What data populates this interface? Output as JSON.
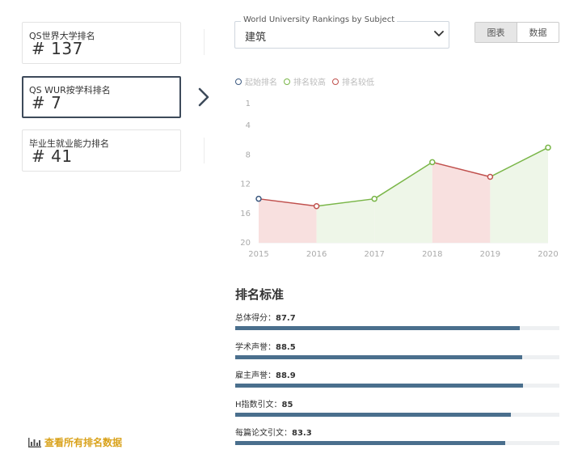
{
  "rank_cards": [
    {
      "label": "QS世界大学排名",
      "value": "# 137",
      "active": false
    },
    {
      "label": "QS WUR按学科排名",
      "value": "# 7",
      "active": true
    },
    {
      "label": "毕业生就业能力排名",
      "value": "# 41",
      "active": false
    }
  ],
  "view_all": {
    "label": "查看所有排名数据",
    "icon": "bar-chart-icon"
  },
  "subject_select": {
    "legend": "World University Rankings by Subject",
    "value": "建筑"
  },
  "view_toggle": {
    "chart_label": "图表",
    "data_label": "数据",
    "selected": "图表"
  },
  "chart_legend": [
    {
      "label": "起始排名",
      "color": "#3d5a80"
    },
    {
      "label": "排名较高",
      "color": "#7ab648"
    },
    {
      "label": "排名较低",
      "color": "#c0504d"
    }
  ],
  "chart_data": {
    "type": "line",
    "x": [
      "2015",
      "2016",
      "2017",
      "2018",
      "2019",
      "2020"
    ],
    "y": [
      14,
      15,
      14,
      9,
      11,
      7
    ],
    "y_ticks": [
      "1",
      "4",
      "8",
      "12",
      "16",
      "20"
    ],
    "ylim": [
      1,
      20
    ],
    "y_inverted": true,
    "colors": {
      "start": "#3d5a80",
      "up": "#7ab648",
      "down": "#c0504d",
      "up_fill": "#eef6e8",
      "down_fill": "#f8e0df"
    }
  },
  "criteria": {
    "title": "排名标准",
    "items": [
      {
        "name": "总体得分：",
        "score": "87.7",
        "value": 87.7
      },
      {
        "name": "学术声誉：",
        "score": "88.5",
        "value": 88.5
      },
      {
        "name": "雇主声誉：",
        "score": "88.9",
        "value": 88.9
      },
      {
        "name": "H指数引文：",
        "score": "85",
        "value": 85
      },
      {
        "name": "每篇论文引文：",
        "score": "83.3",
        "value": 83.3
      }
    ]
  }
}
